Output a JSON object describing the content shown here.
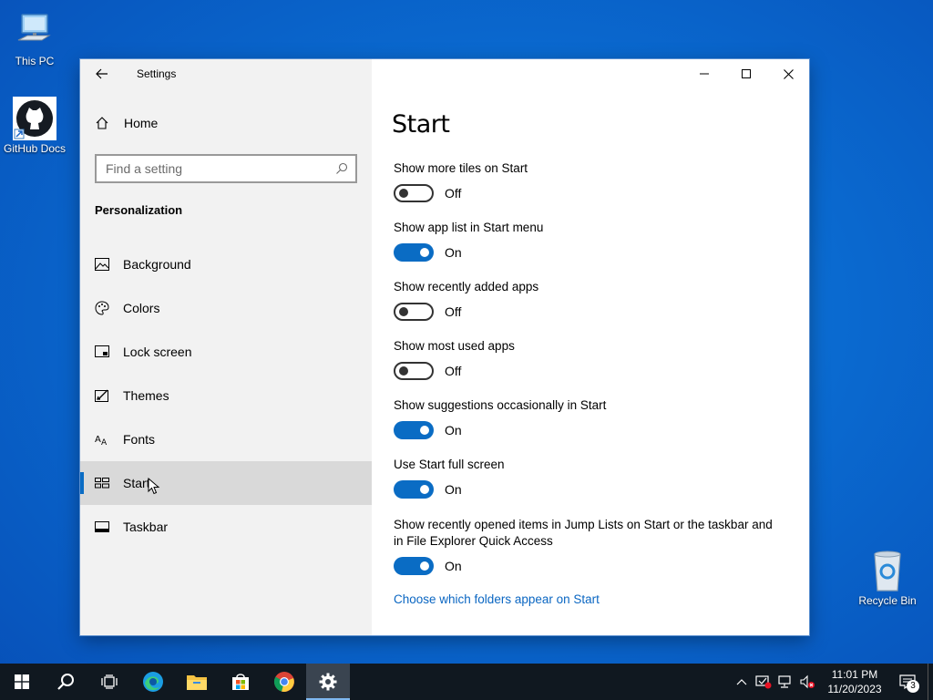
{
  "desktop": {
    "icons": [
      {
        "label": "This PC"
      },
      {
        "label": "GitHub Docs"
      },
      {
        "label": "Recycle Bin"
      }
    ]
  },
  "window": {
    "title": "Settings",
    "controls": {
      "minimize": "minimize-icon",
      "maximize": "maximize-icon",
      "close": "close-icon"
    }
  },
  "sidebar": {
    "home_label": "Home",
    "search_placeholder": "Find a setting",
    "section_title": "Personalization",
    "items": [
      {
        "label": "Background",
        "icon": "image-icon"
      },
      {
        "label": "Colors",
        "icon": "palette-icon"
      },
      {
        "label": "Lock screen",
        "icon": "lock-screen-icon"
      },
      {
        "label": "Themes",
        "icon": "themes-icon"
      },
      {
        "label": "Fonts",
        "icon": "fonts-icon"
      },
      {
        "label": "Start",
        "icon": "start-layout-icon",
        "selected": true
      },
      {
        "label": "Taskbar",
        "icon": "taskbar-icon"
      }
    ]
  },
  "main": {
    "heading": "Start",
    "settings": [
      {
        "label": "Show more tiles on Start",
        "state": "Off"
      },
      {
        "label": "Show app list in Start menu",
        "state": "On"
      },
      {
        "label": "Show recently added apps",
        "state": "Off"
      },
      {
        "label": "Show most used apps",
        "state": "Off"
      },
      {
        "label": "Show suggestions occasionally in Start",
        "state": "On"
      },
      {
        "label": "Use Start full screen",
        "state": "On"
      },
      {
        "label": "Show recently opened items in Jump Lists on Start or the taskbar and in File Explorer Quick Access",
        "state": "On"
      }
    ],
    "link": "Choose which folders appear on Start"
  },
  "taskbar": {
    "apps": [
      "start-icon",
      "search-icon",
      "task-view-icon",
      "edge-icon",
      "file-explorer-icon",
      "store-icon",
      "chrome-icon",
      "settings-icon"
    ],
    "active_app": "settings-icon",
    "tray": {
      "time": "11:01 PM",
      "date": "11/20/2023",
      "notification_count": "3"
    }
  },
  "colors": {
    "accent": "#0a6cc4",
    "link": "#0a66c2",
    "sidebar_bg": "#f2f2f2",
    "selected_bg": "#d9d9d9",
    "taskbar_bg": "#101820"
  }
}
